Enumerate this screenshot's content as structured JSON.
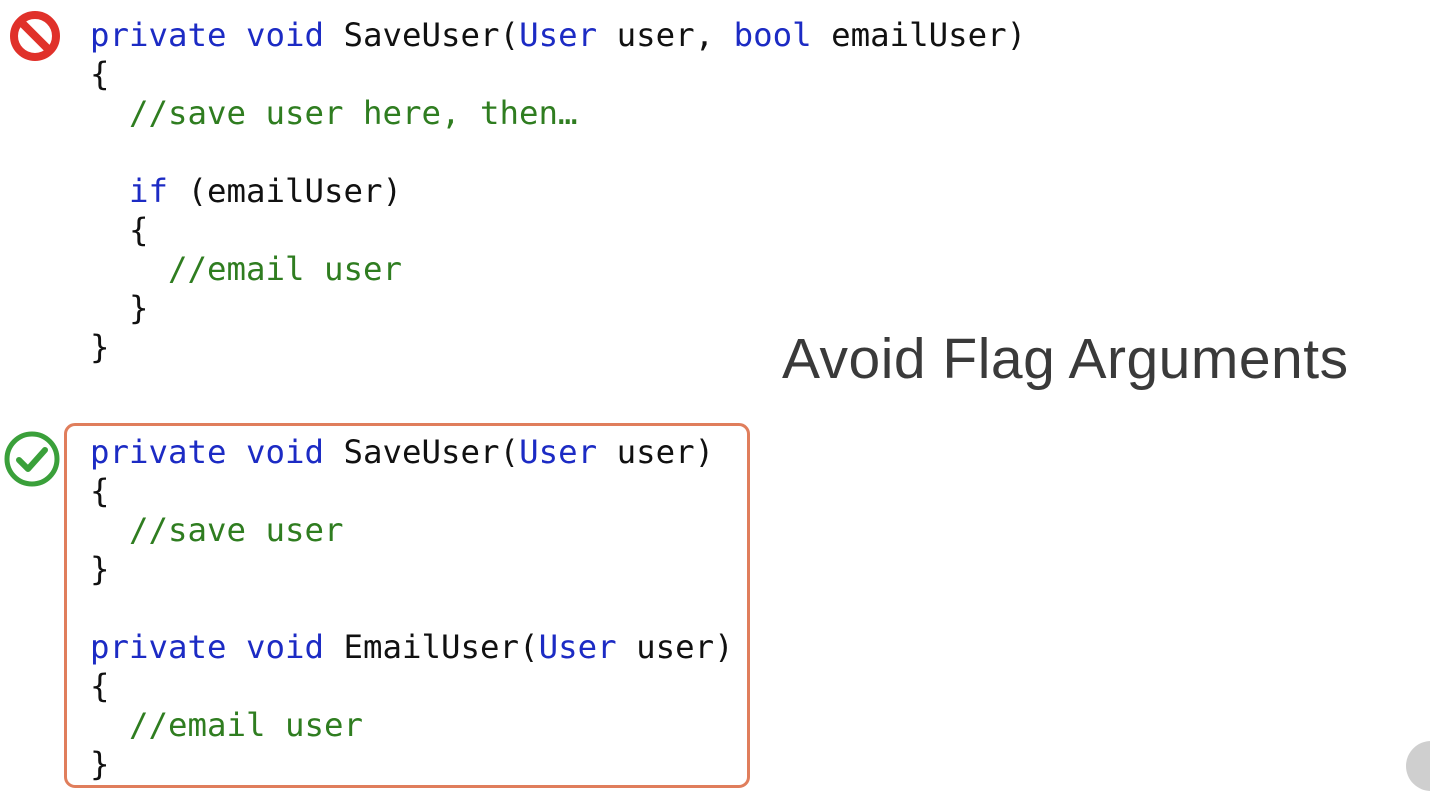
{
  "slide": {
    "title": "Avoid Flag Arguments",
    "colors": {
      "keyword": "#1c2bc4",
      "comment": "#2f7d20",
      "bad": "#e0312a",
      "good": "#3aa03a",
      "highlight_border": "#e07e5c"
    },
    "bad_example": {
      "icon": "no-entry-icon",
      "lines": [
        [
          [
            "kw",
            "private"
          ],
          [
            "tx",
            " "
          ],
          [
            "kw",
            "void"
          ],
          [
            "tx",
            " SaveUser("
          ],
          [
            "kw",
            "User"
          ],
          [
            "tx",
            " user, "
          ],
          [
            "kw",
            "bool"
          ],
          [
            "tx",
            " emailUser)"
          ]
        ],
        [
          [
            "tx",
            "{"
          ]
        ],
        [
          [
            "cm",
            "  //save user here, then…"
          ]
        ],
        [
          [
            "tx",
            ""
          ]
        ],
        [
          [
            "tx",
            "  "
          ],
          [
            "kw",
            "if"
          ],
          [
            "tx",
            " (emailUser)"
          ]
        ],
        [
          [
            "tx",
            "  {"
          ]
        ],
        [
          [
            "cm",
            "    //email user"
          ]
        ],
        [
          [
            "tx",
            "  }"
          ]
        ],
        [
          [
            "tx",
            "}"
          ]
        ]
      ]
    },
    "good_example": {
      "icon": "checkmark-circle-icon",
      "lines": [
        [
          [
            "kw",
            "private"
          ],
          [
            "tx",
            " "
          ],
          [
            "kw",
            "void"
          ],
          [
            "tx",
            " SaveUser("
          ],
          [
            "kw",
            "User"
          ],
          [
            "tx",
            " user)"
          ]
        ],
        [
          [
            "tx",
            "{"
          ]
        ],
        [
          [
            "cm",
            "  //save user"
          ]
        ],
        [
          [
            "tx",
            "}"
          ]
        ],
        [
          [
            "tx",
            ""
          ]
        ],
        [
          [
            "kw",
            "private"
          ],
          [
            "tx",
            " "
          ],
          [
            "kw",
            "void"
          ],
          [
            "tx",
            " EmailUser("
          ],
          [
            "kw",
            "User"
          ],
          [
            "tx",
            " user)"
          ]
        ],
        [
          [
            "tx",
            "{"
          ]
        ],
        [
          [
            "cm",
            "  //email user"
          ]
        ],
        [
          [
            "tx",
            "}"
          ]
        ]
      ]
    }
  }
}
